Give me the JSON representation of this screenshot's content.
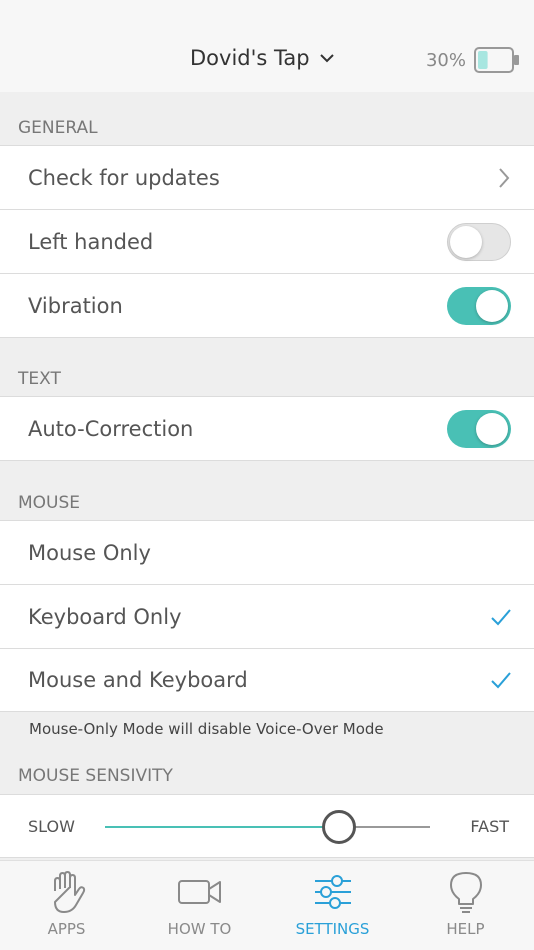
{
  "header": {
    "device_name": "Dovid's Tap",
    "battery_percent": "30%",
    "battery_level": 0.3
  },
  "sections": {
    "general": "GENERAL",
    "text": "TEXT",
    "mouse": "MOUSE",
    "mouse_sensitivity": "MOUSE SENSIVITY"
  },
  "general": {
    "check_updates": "Check for updates",
    "left_handed": "Left  handed",
    "left_handed_on": false,
    "vibration": "Vibration",
    "vibration_on": true
  },
  "text": {
    "auto_correction": "Auto-Correction",
    "auto_correction_on": true
  },
  "mouse": {
    "mouse_only": "Mouse Only",
    "mouse_only_checked": false,
    "keyboard_only": "Keyboard Only",
    "keyboard_only_checked": true,
    "mouse_and_keyboard": "Mouse and Keyboard",
    "mouse_and_keyboard_checked": true,
    "footnote": "Mouse-Only Mode will disable Voice-Over Mode"
  },
  "sensitivity": {
    "min_label": "SLOW",
    "max_label": "FAST",
    "value": 0.72
  },
  "tabs": [
    {
      "label": "APPS",
      "icon": "hand-icon",
      "active": false
    },
    {
      "label": "HOW TO",
      "icon": "video-camera-icon",
      "active": false
    },
    {
      "label": "SETTINGS",
      "icon": "sliders-icon",
      "active": true
    },
    {
      "label": "HELP",
      "icon": "lightbulb-icon",
      "active": false
    }
  ],
  "colors": {
    "accent": "#49c0b5",
    "active_tab": "#2aa0d8",
    "check": "#2aa0d8"
  }
}
